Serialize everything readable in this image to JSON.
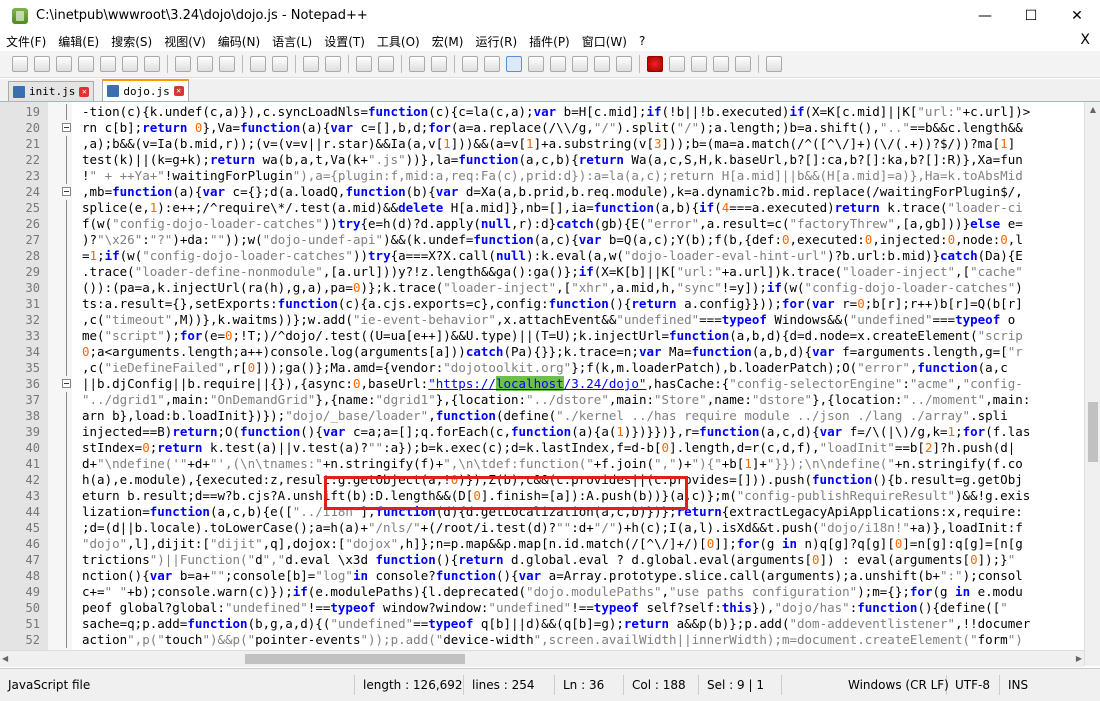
{
  "window": {
    "title": "C:\\inetpub\\wwwroot\\3.24\\dojo\\dojo.js - Notepad++",
    "minimize": "—",
    "maximize": "☐",
    "close": "✕"
  },
  "menu": {
    "items": [
      "文件(F)",
      "编辑(E)",
      "搜索(S)",
      "视图(V)",
      "编码(N)",
      "语言(L)",
      "设置(T)",
      "工具(O)",
      "宏(M)",
      "运行(R)",
      "插件(P)",
      "窗口(W)",
      "?"
    ],
    "close_doc": "X"
  },
  "tabs": [
    {
      "label": "init.js",
      "active": false
    },
    {
      "label": "dojo.js",
      "active": true
    }
  ],
  "editor": {
    "lines": [
      {
        "n": "19",
        "fold": "bar",
        "code": "-tion(c){k.undef(c,a)}),c.syncLoadNls=function(c){c=la(c,a);var b=H[c.mid];if(!b||!b.executed)if(X=K[c.mid]||K[\"url:\"+c.url])>"
      },
      {
        "n": "20",
        "fold": "mark",
        "code": "rn c[b];return 0},Va=function(a){var c=[],b,d;for(a=a.replace(/\\\\/g,\"/\").split(\"/\");a.length;)b=a.shift(),\"..\"==b&&c.length&&"
      },
      {
        "n": "21",
        "fold": "bar",
        "code": ",a);b&&(v=Ia(b.mid,r));(v=(v=v||r.star)&&Ia(a,v[1]))&&(a=v[1]+a.substring(v[3]));b=(ma=a.match(/^([^\\/]+)(\\/(.+))?$/))?ma[1]"
      },
      {
        "n": "22",
        "fold": "bar",
        "code": "test(k)||(k=g+k);return wa(b,a,t,Va(k+\".js\"))},la=function(a,c,b){return Wa(a,c,S,H,k.baseUrl,b?[]:ca,b?[]:ka,b?[]:R)},Xa=fun"
      },
      {
        "n": "23",
        "fold": "bar",
        "code": "!\" + ++Ya+\"!waitingForPlugin\"),a={plugin:f,mid:a,req:Fa(c),prid:d}):a=la(a,c);return H[a.mid]||b&&(H[a.mid]=a)},Ha=k.toAbsMid"
      },
      {
        "n": "24",
        "fold": "mark",
        "code": ",mb=function(a){var c={};d(a.loadQ,function(b){var d=Xa(a,b.prid,b.req.module),k=a.dynamic?b.mid.replace(/waitingForPlugin$/,"
      },
      {
        "n": "25",
        "fold": "bar",
        "code": "splice(e,1):e++;/^require\\*/.test(a.mid)&&delete H[a.mid]},nb=[],ia=function(a,b){if(4===a.executed)return k.trace(\"loader-ci"
      },
      {
        "n": "26",
        "fold": "bar",
        "code": "f(w(\"config-dojo-loader-catches\"))try{e=h(d)?d.apply(null,r):d}catch(gb){E(\"error\",a.result=c(\"factoryThrew\",[a,gb]))}else e="
      },
      {
        "n": "27",
        "fold": "bar",
        "code": ")?\"\\x26\":\"?\")+da:\"\"));w(\"dojo-undef-api\")&&(k.undef=function(a,c){var b=Q(a,c);Y(b);f(b,{def:0,executed:0,injected:0,node:0,l"
      },
      {
        "n": "28",
        "fold": "bar",
        "code": "=1;if(w(\"config-dojo-loader-catches\"))try{a===X?X.call(null):k.eval(a,w(\"dojo-loader-eval-hint-url\")?b.url:b.mid)}catch(Da){E"
      },
      {
        "n": "29",
        "fold": "bar",
        "code": ".trace(\"loader-define-nonmodule\",[a.url]))y?!z.length&&ga():ga()};if(X=K[b]||K[\"url:\"+a.url])k.trace(\"loader-inject\",[\"cache\""
      },
      {
        "n": "30",
        "fold": "bar",
        "code": "()):(pa=a,k.injectUrl(ra(h),g,a),pa=0)};k.trace(\"loader-inject\",[\"xhr\",a.mid,h,\"sync\"!=y]);if(w(\"config-dojo-loader-catches\")"
      },
      {
        "n": "31",
        "fold": "bar",
        "code": "ts:a.result={},setExports:function(c){a.cjs.exports=c},config:function(){return a.config}}));for(var r=0;b[r];r++)b[r]=Q(b[r]"
      },
      {
        "n": "32",
        "fold": "bar",
        "code": ",c(\"timeout\",M))},k.waitms))};w.add(\"ie-event-behavior\",x.attachEvent&&\"undefined\"===typeof Windows&&(\"undefined\"===typeof o"
      },
      {
        "n": "33",
        "fold": "bar",
        "code": "me(\"script\");for(e=0;!T;)/^dojo/.test((U=ua[e++])&&U.type)||(T=U);k.injectUrl=function(a,b,d){d=d.node=x.createElement(\"scrip"
      },
      {
        "n": "34",
        "fold": "bar",
        "code": "0;a<arguments.length;a++)console.log(arguments[a]))catch(Pa){}};k.trace=n;var Ma=function(a,b,d){var f=arguments.length,g=[\"r"
      },
      {
        "n": "35",
        "fold": "bar",
        "code": ",c(\"ieDefineFailed\",r[0]));ga()};Ma.amd={vendor:\"dojotoolkit.org\"};f(k,m.loaderPatch),b.loaderPatch);O(\"error\",function(a,c"
      },
      {
        "n": "36",
        "fold": "mark",
        "code": "||b.djConfig||b.require||{}),{async:0,baseUrl:\"https://localhost/3.24/dojo\",hasCache:{\"config-selectorEngine\":\"acme\",\"config-"
      },
      {
        "n": "37",
        "fold": "bar",
        "code": "\"../dgrid1\",main:\"OnDemandGrid\"},{name:\"dgrid1\"},{location:\"../dstore\",main:\"Store\",name:\"dstore\"},{location:\"../moment\",main:"
      },
      {
        "n": "38",
        "fold": "bar",
        "code": "arn b},load:b.loadInit})});\"dojo/_base/loader\",function(define(\"./kernel ../has require module ../json ./lang ./array\".spli"
      },
      {
        "n": "39",
        "fold": "bar",
        "code": "injected==B)return;O(function(){var c=a;a=[];q.forEach(c,function(a){a(1)})}})},r=function(a,c,d){var f=/\\(|\\)/g,k=1;for(f.las"
      },
      {
        "n": "40",
        "fold": "bar",
        "code": "stIndex=0;return k.test(a)||v.test(a)?\"\":a});b=k.exec(c);d=k.lastIndex,f=d-b[0].length,d=r(c,d,f),\"loadInit\"==b[2]?h.push(d|"
      },
      {
        "n": "41",
        "fold": "bar",
        "code": "d+\"\\ndefine('\"+d+\"',(\\n\\tnames:\"+n.stringify(f)+\",\\n\\tdef:function(\"+f.join(\",\")+\"){\"+b[1]+\"}});\\n\\ndefine(\"+n.stringify(f.co"
      },
      {
        "n": "42",
        "fold": "bar",
        "code": "h(a),e.module),{executed:z,result:g.getObject(a,!0)});Z(b);c&&(c.provides||(c.provides=[])).push(function(){b.result=g.getObj"
      },
      {
        "n": "43",
        "fold": "bar",
        "code": "eturn b.result;d==w?b.cjs?A.unshift(b):D.length&&(D[0].finish=[a]):A.push(b))}(a,c)};m(\"config-publishRequireResult\")&&!g.exis"
      },
      {
        "n": "44",
        "fold": "bar",
        "code": "lization=function(a,c,b){e([\"../i18n\"],function(d){d.getLocalization(a,c,b)})};return{extractLegacyApiApplications:x,require:"
      },
      {
        "n": "45",
        "fold": "bar",
        "code": ";d=(d||b.locale).toLowerCase();a=h(a)+\"/nls/\"+(/root/i.test(d)?\"\":d+\"/\")+h(c);I(a,l).isXd&&t.push(\"dojo/i18n!\"+a)},loadInit:f"
      },
      {
        "n": "46",
        "fold": "bar",
        "code": "\"dojo\",l],dijit:[\"dijit\",q],dojox:[\"dojox\",h]};n=p.map&&p.map[n.id.match(/[^\\/]+/)[0]];for(g in n)q[g]?q[g][0]=n[g]:q[g]=[n[g"
      },
      {
        "n": "47",
        "fold": "bar",
        "code": "trictions\")||Function(\"d\",\"d.eval \\x3d function(){return d.global.eval ? d.global.eval(arguments[0]) : eval(arguments[0]);}\""
      },
      {
        "n": "48",
        "fold": "bar",
        "code": "nction(){var b=a+\"\";console[b]=\"log\"in console?function(){var a=Array.prototype.slice.call(arguments);a.unshift(b+\":\");consol"
      },
      {
        "n": "49",
        "fold": "bar",
        "code": "c+=\" \"+b);console.warn(c)});if(e.modulePaths){l.deprecated(\"dojo.modulePaths\",\"use paths configuration\");m={};for(g in e.modu"
      },
      {
        "n": "50",
        "fold": "bar",
        "code": "peof global?global:\"undefined\"!==typeof window?window:\"undefined\"!==typeof self?self:this}),\"dojo/has\":function(){define([\""
      },
      {
        "n": "51",
        "fold": "bar",
        "code": "sache=q;p.add=function(b,g,a,d){(\"undefined\"==typeof q[b]||d)&&(q[b]=g);return a&&p(b)};p.add(\"dom-addeventlistener\",!!documer"
      },
      {
        "n": "52",
        "fold": "bar",
        "code": "action\",p(\"touch\")&&p(\"pointer-events\"));p.add(\"device-width\",screen.availWidth||innerWidth);m=document.createElement(\"form\")"
      }
    ]
  },
  "status": {
    "file_type": "JavaScript file",
    "length": "length : 126,692",
    "lines": "lines : 254",
    "ln": "Ln : 36",
    "col": "Col : 188",
    "sel": "Sel : 9 | 1",
    "eol": "Windows (CR LF)",
    "encoding": "UTF-8",
    "ins": "INS"
  }
}
